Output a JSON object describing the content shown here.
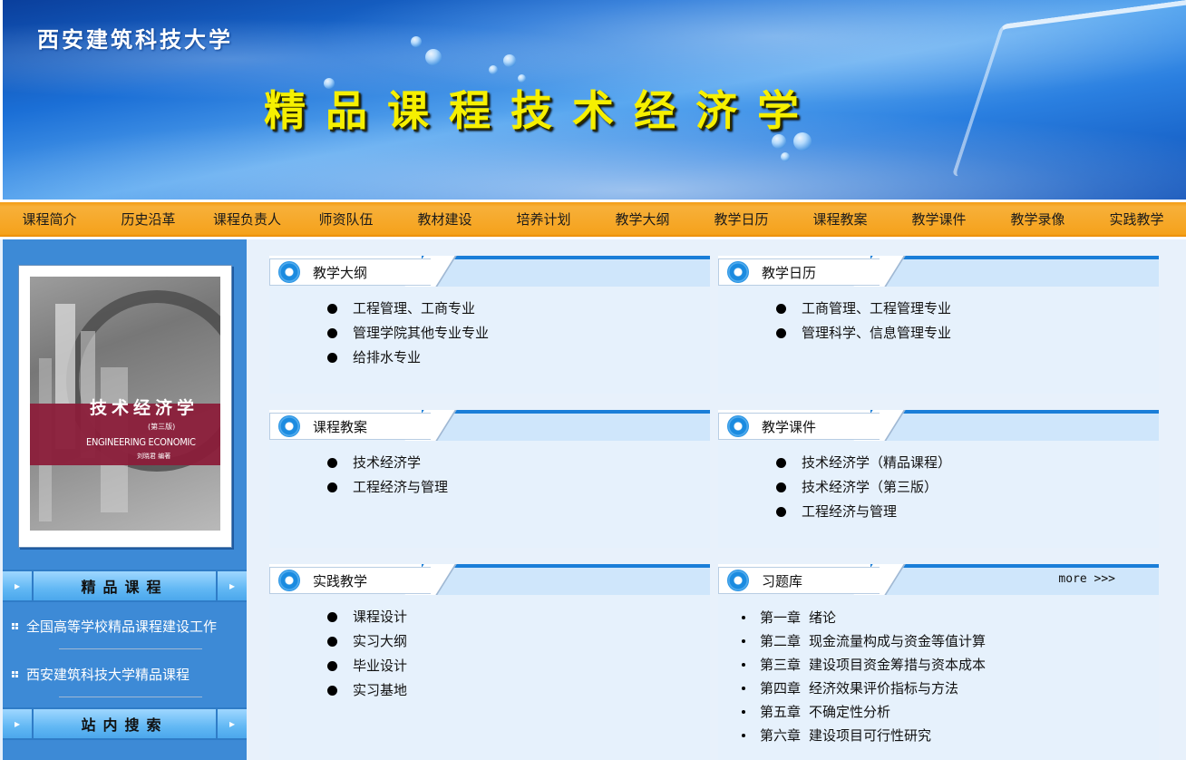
{
  "banner": {
    "university_name": "西安建筑科技大学",
    "course_title": "精品课程技术经济学"
  },
  "nav": {
    "items": [
      "课程简介",
      "历史沿革",
      "课程负责人",
      "师资队伍",
      "教材建设",
      "培养计划",
      "教学大纲",
      "教学日历",
      "课程教案",
      "教学课件",
      "教学录像",
      "实践教学"
    ]
  },
  "sidebar": {
    "book": {
      "title": "技术经济学",
      "edition": "(第三版)",
      "english_title": "ENGINEERING ECONOMIC",
      "author": "刘晓君 编著"
    },
    "section1": {
      "label": "精品课程",
      "links": [
        "全国高等学校精品课程建设工作",
        "西安建筑科技大学精品课程"
      ]
    },
    "section2": {
      "label": "站内搜索"
    }
  },
  "panels": {
    "syllabus": {
      "title": "教学大纲",
      "items": [
        "工程管理、工商专业",
        "管理学院其他专业专业",
        "给排水专业"
      ]
    },
    "calendar": {
      "title": "教学日历",
      "items": [
        "工商管理、工程管理专业",
        "管理科学、信息管理专业"
      ]
    },
    "lesson_plans": {
      "title": "课程教案",
      "items": [
        "技术经济学",
        "工程经济与管理"
      ]
    },
    "courseware": {
      "title": "教学课件",
      "items": [
        "技术经济学（精品课程）",
        "技术经济学（第三版）",
        "工程经济与管理"
      ]
    },
    "practice": {
      "title": "实践教学",
      "items": [
        "课程设计",
        "实习大纲",
        "毕业设计",
        "实习基地"
      ]
    },
    "exercises": {
      "title": "习题库",
      "more": "more >>>",
      "chapters": [
        {
          "num": "第一章",
          "name": "绪论"
        },
        {
          "num": "第二章",
          "name": "现金流量构成与资金等值计算"
        },
        {
          "num": "第三章",
          "name": "建设项目资金筹措与资本成本"
        },
        {
          "num": "第四章",
          "name": "经济效果评价指标与方法"
        },
        {
          "num": "第五章",
          "name": "不确定性分析"
        },
        {
          "num": "第六章",
          "name": "建设项目可行性研究"
        }
      ]
    }
  },
  "colors": {
    "nav_orange": "#f5a21c",
    "sidebar_blue": "#3d8ad6",
    "content_bg": "#e8f1fb",
    "title_yellow": "#f6f000"
  }
}
